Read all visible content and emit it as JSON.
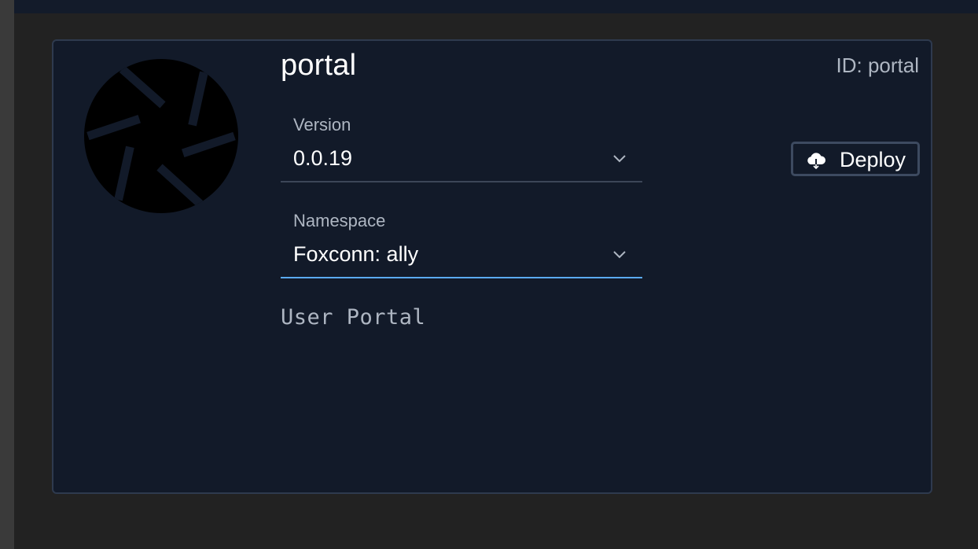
{
  "app": {
    "title": "portal",
    "id_text": "ID: portal",
    "description": "User Portal",
    "logo_icon": "aperture-icon"
  },
  "version_field": {
    "label": "Version",
    "value": "0.0.19"
  },
  "namespace_field": {
    "label": "Namespace",
    "value": "Foxconn: ally"
  },
  "deploy_button": {
    "label": "Deploy",
    "icon": "cloud-download-icon"
  },
  "colors": {
    "page_background": "#222222",
    "card_background": "#121a29",
    "card_border": "#2e3a4e",
    "focus_accent": "#5aa9f0",
    "primary_text": "#ffffff",
    "secondary_text": "#aeb6c2"
  }
}
